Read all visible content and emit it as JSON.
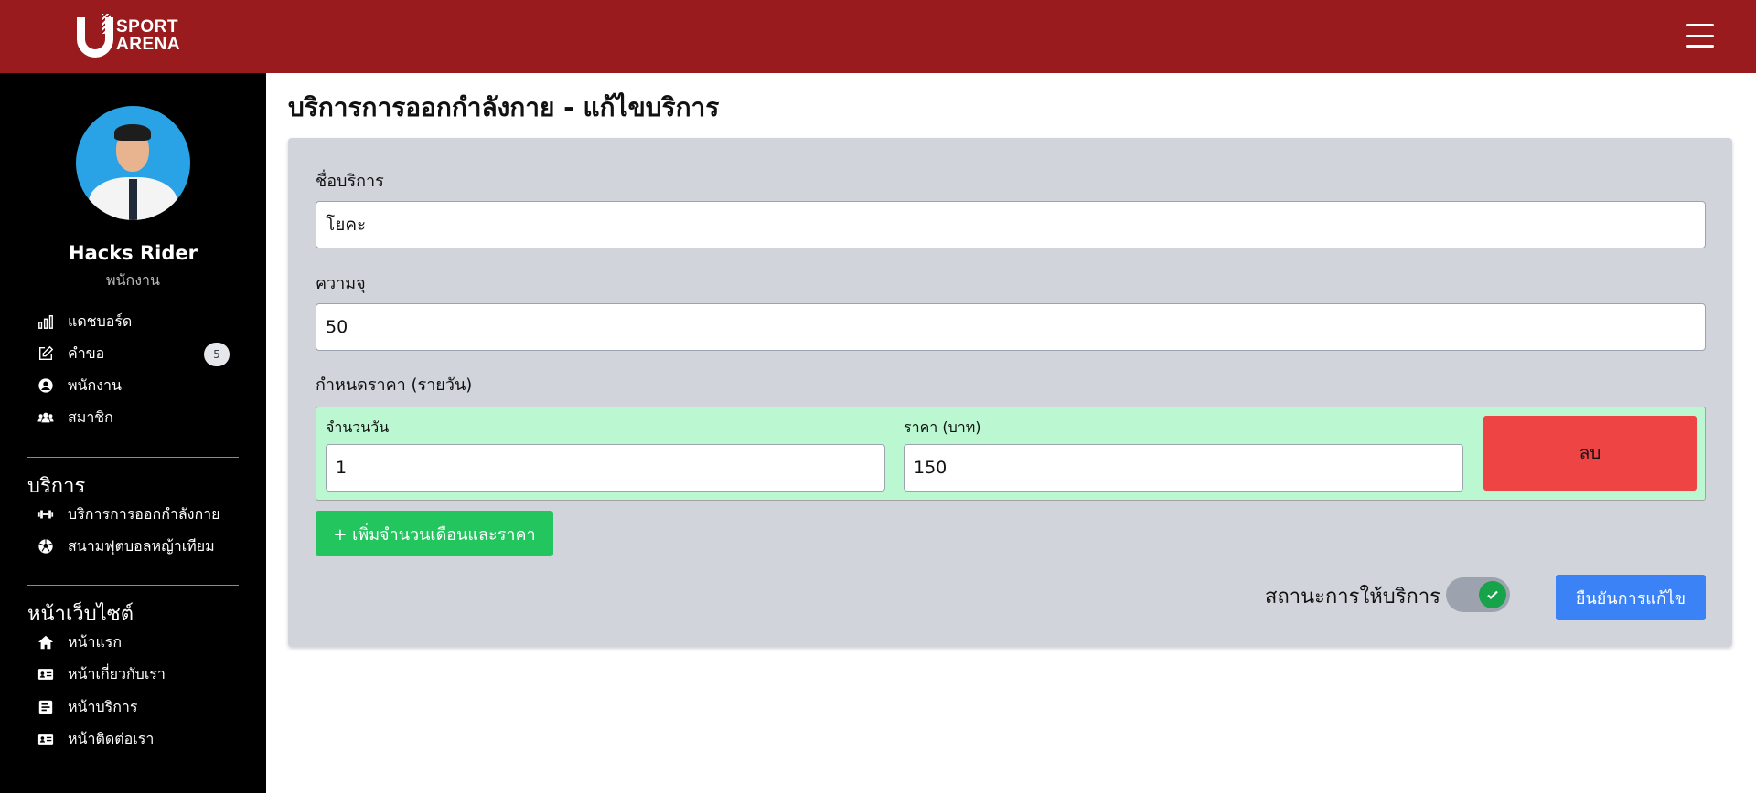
{
  "header": {
    "logo_text_line1": "SPORT",
    "logo_text_line2": "ARENA"
  },
  "user": {
    "name": "Hacks Rider",
    "role": "พนักงาน"
  },
  "sidebar": {
    "items": [
      {
        "label": "แดชบอร์ด",
        "icon": "chart-bar-icon"
      },
      {
        "label": "คำขอ",
        "icon": "edit-icon",
        "badge": "5"
      },
      {
        "label": "พนักงาน",
        "icon": "user-circle-icon"
      },
      {
        "label": "สมาชิก",
        "icon": "users-icon"
      }
    ],
    "services_title": "บริการ",
    "services": [
      {
        "label": "บริการการออกกำลังกาย",
        "icon": "dumbbell-icon"
      },
      {
        "label": "สนามฟุตบอลหญ้าเทียม",
        "icon": "soccer-ball-icon"
      }
    ],
    "website_title": "หน้าเว็บไซต์",
    "website": [
      {
        "label": "หน้าแรก",
        "icon": "home-icon"
      },
      {
        "label": "หน้าเกี่ยวกับเรา",
        "icon": "id-card-icon"
      },
      {
        "label": "หน้าบริการ",
        "icon": "list-alt-icon"
      },
      {
        "label": "หน้าติดต่อเรา",
        "icon": "id-card-icon"
      }
    ]
  },
  "main": {
    "title": "บริการการออกกำลังกาย - แก้ไขบริการ",
    "service_name_label": "ชื่อบริการ",
    "service_name_value": "โยคะ",
    "capacity_label": "ความจุ",
    "capacity_value": "50",
    "pricing_label": "กำหนดราคา (รายวัน)",
    "pricing_rows": [
      {
        "days_label": "จำนวนวัน",
        "days_value": "1",
        "price_label": "ราคา (บาท)",
        "price_value": "150",
        "delete_label": "ลบ"
      }
    ],
    "add_button": "+ เพิ่มจำนวนเดือนและราคา",
    "status_label": "สถานะการให้บริการ",
    "status_on": true,
    "confirm_button": "ยืนยันการแก้ไข"
  },
  "colors": {
    "header": "#991b1e",
    "sidebar": "#000000",
    "card": "#d1d5db",
    "price_row": "#bbf7d0",
    "delete": "#ef4444",
    "add": "#22c55e",
    "confirm": "#3b82f6"
  }
}
